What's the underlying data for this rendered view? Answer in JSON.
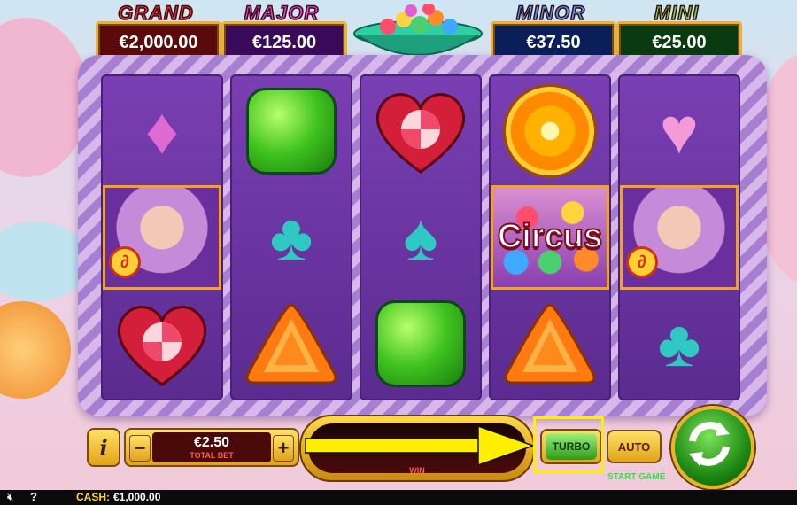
{
  "jackpots": [
    {
      "title": "GRAND",
      "value": "€2,000.00",
      "color": "#e0302c",
      "bg": "#5a0a0a"
    },
    {
      "title": "MAJOR",
      "value": "€125.00",
      "color": "#e040e0",
      "bg": "#3a0a5a"
    },
    {
      "title": "MINOR",
      "value": "€37.50",
      "color": "#3fa0ff",
      "bg": "#0a1f5a"
    },
    {
      "title": "MINI",
      "value": "€25.00",
      "color": "#6ce03c",
      "bg": "#0a3a10"
    }
  ],
  "reels": [
    [
      "diamond",
      "feature-portrait",
      "heart-candy"
    ],
    [
      "green-gem",
      "club",
      "orange-triangle"
    ],
    [
      "heart-candy",
      "spade",
      "green-gem"
    ],
    [
      "orange-candy",
      "feature-circus",
      "orange-triangle"
    ],
    [
      "heart",
      "feature-portrait",
      "club"
    ]
  ],
  "feature": {
    "circus_text": "Circus"
  },
  "controls": {
    "info_label": "i",
    "minus_label": "−",
    "plus_label": "+",
    "bet_value": "€2.50",
    "bet_label": "TOTAL BET",
    "win_label": "WIN",
    "turbo_label": "TURBO",
    "auto_label": "AUTO",
    "start_label": "START GAME"
  },
  "status_bar": {
    "cash_label": "CASH:",
    "cash_value": "€1,000.00",
    "sound_icon": "speaker-muted-icon",
    "help_label": "?"
  },
  "highlight_color": "#ffee00"
}
